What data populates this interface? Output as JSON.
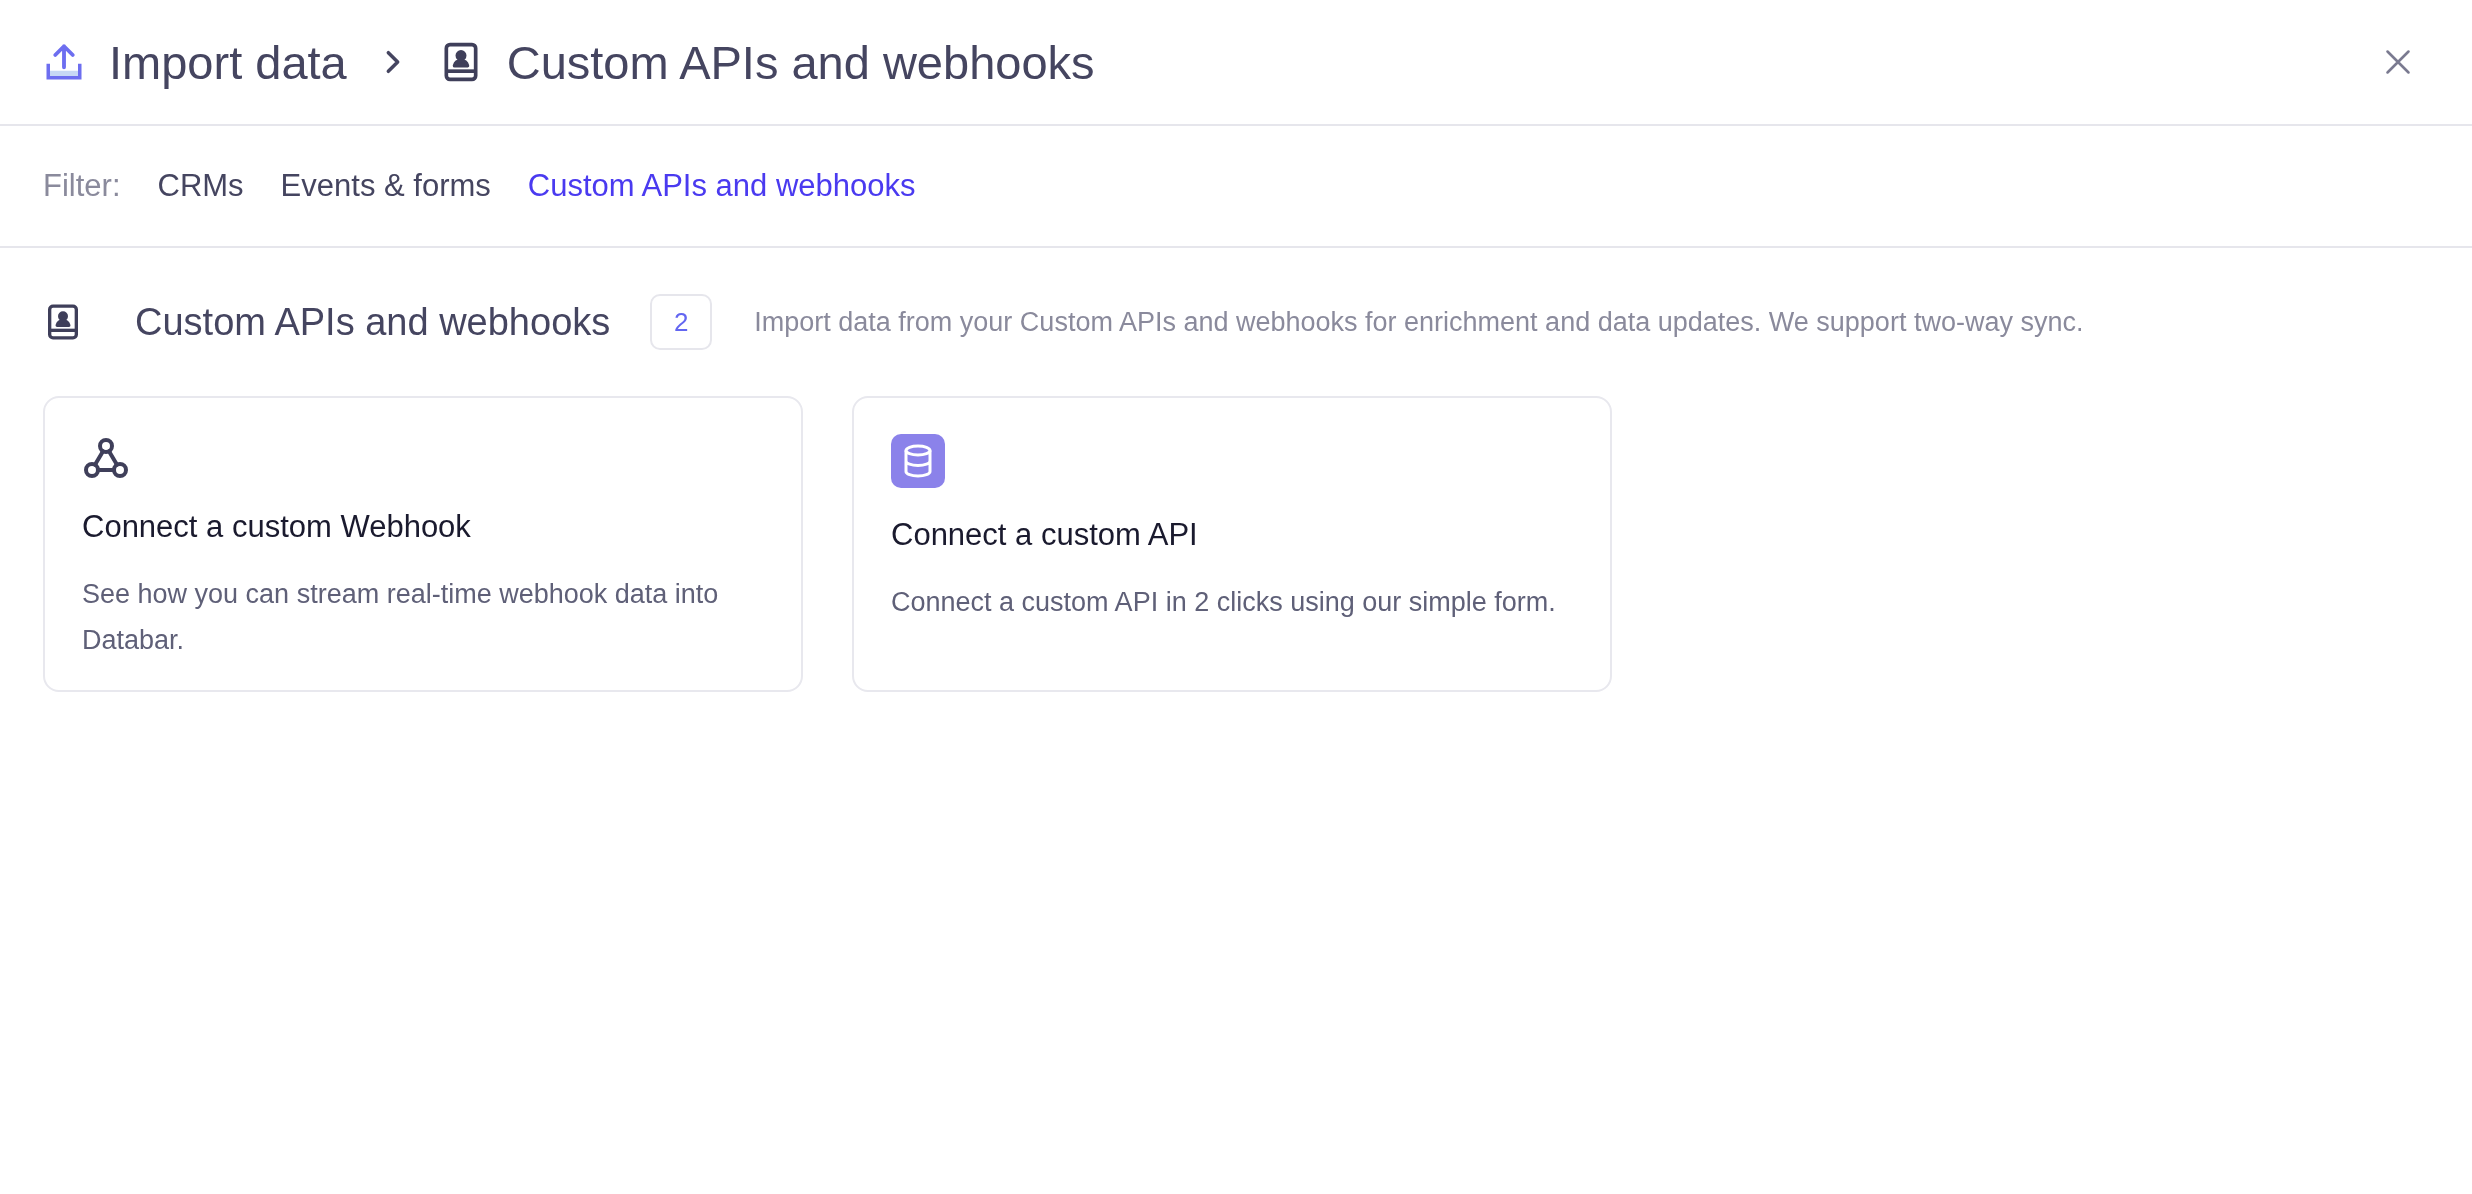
{
  "breadcrumb": [
    "Import data",
    "Custom APIs and webhooks"
  ],
  "filter": {
    "label": "Filter:",
    "options": [
      {
        "label": "CRMs",
        "selected": false
      },
      {
        "label": "Events & forms",
        "selected": false
      },
      {
        "label": "Custom APIs and webhooks",
        "selected": true
      }
    ]
  },
  "section": {
    "title": "Custom APIs and webhooks",
    "count": "2",
    "description": "Import data from your Custom APIs and webhooks for enrichment and data updates. We support two-way sync."
  },
  "cards": [
    {
      "kind": "webhook",
      "title": "Connect a custom Webhook",
      "description": "See how you can stream real-time webhook data into Databar."
    },
    {
      "kind": "api",
      "title": "Connect a custom API",
      "description": "Connect a custom API in 2 clicks using our simple form."
    }
  ]
}
